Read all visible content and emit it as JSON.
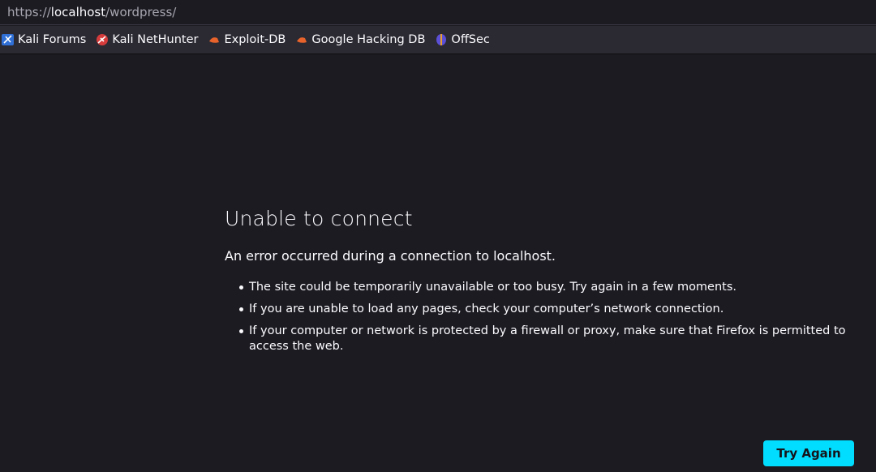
{
  "urlbar": {
    "scheme": "https://",
    "host": "localhost",
    "path": "/wordpress/"
  },
  "bookmarks": [
    {
      "label": "Kali Forums",
      "icon": "kali-forums-icon"
    },
    {
      "label": "Kali NetHunter",
      "icon": "kali-nethunter-icon"
    },
    {
      "label": "Exploit-DB",
      "icon": "exploit-db-icon"
    },
    {
      "label": "Google Hacking DB",
      "icon": "ghdb-icon"
    },
    {
      "label": "OffSec",
      "icon": "offsec-icon"
    }
  ],
  "error": {
    "title": "Unable to connect",
    "lead": "An error occurred during a connection to localhost.",
    "reasons": [
      "The site could be temporarily unavailable or too busy. Try again in a few moments.",
      "If you are unable to load any pages, check your computer’s network connection.",
      "If your computer or network is protected by a firewall or proxy, make sure that Firefox is permitted to access the web."
    ],
    "button_label": "Try Again"
  },
  "colors": {
    "page_bg": "#1c1b22",
    "toolbar_bg": "#2b2a33",
    "accent": "#00ddff"
  }
}
